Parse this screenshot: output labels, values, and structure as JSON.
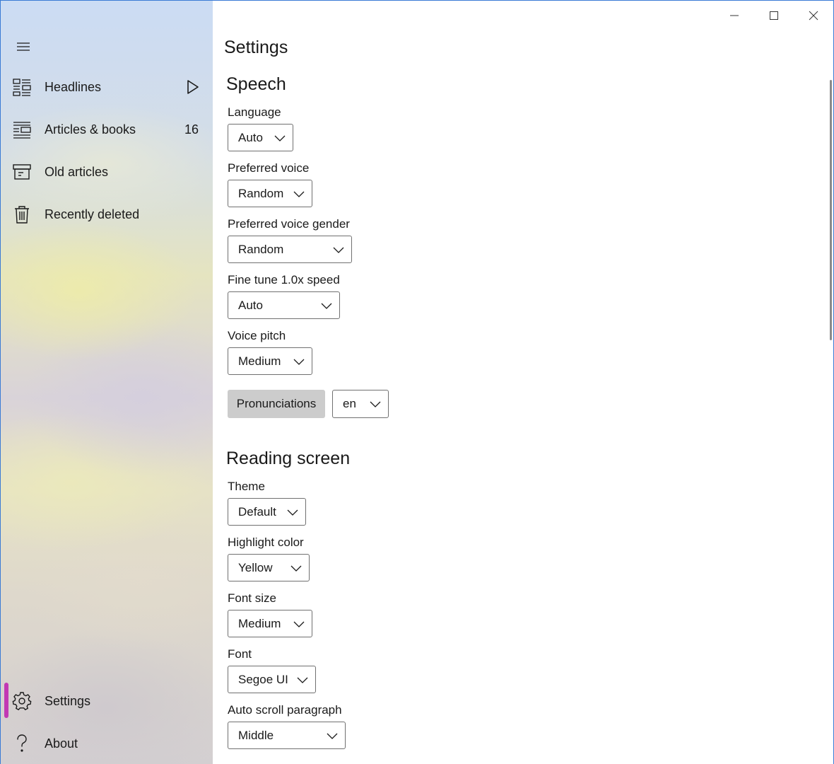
{
  "window": {
    "controls": [
      "minimize",
      "maximize",
      "close"
    ]
  },
  "sidebar": {
    "menu_icon": "hamburger-menu-icon",
    "items": [
      {
        "label": "Headlines",
        "icon": "headlines-icon",
        "trailing": "play-icon"
      },
      {
        "label": "Articles & books",
        "icon": "articles-list-icon",
        "count": "16"
      },
      {
        "label": "Old articles",
        "icon": "archive-box-icon"
      },
      {
        "label": "Recently deleted",
        "icon": "trash-icon"
      }
    ],
    "footer_items": [
      {
        "label": "Settings",
        "icon": "gear-icon",
        "selected": true
      },
      {
        "label": "About",
        "icon": "question-mark-icon"
      }
    ],
    "accent_color": "#c239b3"
  },
  "main": {
    "title": "Settings",
    "speech": {
      "heading": "Speech",
      "language": {
        "label": "Language",
        "value": "Auto"
      },
      "preferred_voice": {
        "label": "Preferred voice",
        "value": "Random"
      },
      "preferred_voice_gender": {
        "label": "Preferred voice gender",
        "value": "Random"
      },
      "fine_tune_speed": {
        "label": "Fine tune 1.0x speed",
        "value": "Auto"
      },
      "voice_pitch": {
        "label": "Voice pitch",
        "value": "Medium"
      },
      "pronunciations_button": "Pronunciations",
      "pronunciations_lang": {
        "value": "en"
      }
    },
    "reading_screen": {
      "heading": "Reading screen",
      "theme": {
        "label": "Theme",
        "value": "Default"
      },
      "highlight_color": {
        "label": "Highlight color",
        "value": "Yellow"
      },
      "font_size": {
        "label": "Font size",
        "value": "Medium"
      },
      "font": {
        "label": "Font",
        "value": "Segoe UI"
      },
      "auto_scroll_paragraph": {
        "label": "Auto scroll paragraph",
        "value": "Middle"
      }
    }
  }
}
